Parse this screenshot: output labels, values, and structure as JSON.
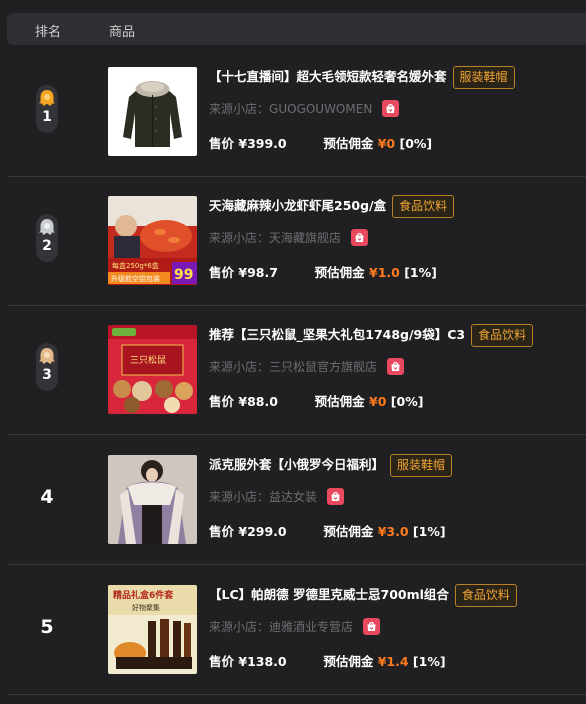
{
  "header": {
    "rank_label": "排名",
    "goods_label": "商品"
  },
  "labels": {
    "shop_prefix": "来源小店：",
    "price_prefix": "售价",
    "commission_prefix": "预估佣金"
  },
  "colors": {
    "tag_text": "#f1a533",
    "commission": "#ff7a1e",
    "medal_gold": "#f5a623",
    "medal_silver": "#c9ccd1",
    "medal_bronze": "#e3b98a",
    "shop_icon": "#e8495e"
  },
  "items": [
    {
      "rank": "1",
      "medal": "gold-medal-icon",
      "title": "【十七直播间】超大毛领短款轻奢名媛外套",
      "category": "服装鞋帽",
      "shop": "GUOGOUWOMEN",
      "price": "¥399.0",
      "commission": "¥0",
      "rate": "[0%]"
    },
    {
      "rank": "2",
      "medal": "silver-medal-icon",
      "title": "天海藏麻辣小龙虾虾尾250g/盒",
      "category": "食品饮料",
      "shop": "天海藏旗舰店",
      "price": "¥98.7",
      "commission": "¥1.0",
      "rate": "[1%]",
      "image_text": {
        "line1": "每盒250g*6盒",
        "line2": "升级航空铝包装",
        "badge": "99"
      }
    },
    {
      "rank": "3",
      "medal": "bronze-medal-icon",
      "title": "推荐【三只松鼠_坚果大礼包1748g/9袋】C3",
      "category": "食品饮料",
      "shop": "三只松鼠官方旗舰店",
      "price": "¥88.0",
      "commission": "¥0",
      "rate": "[0%]",
      "image_text": {
        "brand": "三只松鼠"
      }
    },
    {
      "rank": "4",
      "medal": "",
      "title": "派克服外套【小俄罗今日福利】",
      "category": "服装鞋帽",
      "shop": "益达女装",
      "price": "¥299.0",
      "commission": "¥3.0",
      "rate": "[1%]"
    },
    {
      "rank": "5",
      "medal": "",
      "title": "【LC】帕朗德 罗德里克威士忌700ml组合",
      "category": "食品饮料",
      "shop": "迪雅酒业专营店",
      "price": "¥138.0",
      "commission": "¥1.4",
      "rate": "[1%]",
      "image_text": {
        "line1": "精品礼盒6件套",
        "line2": "好物聚集"
      }
    }
  ]
}
